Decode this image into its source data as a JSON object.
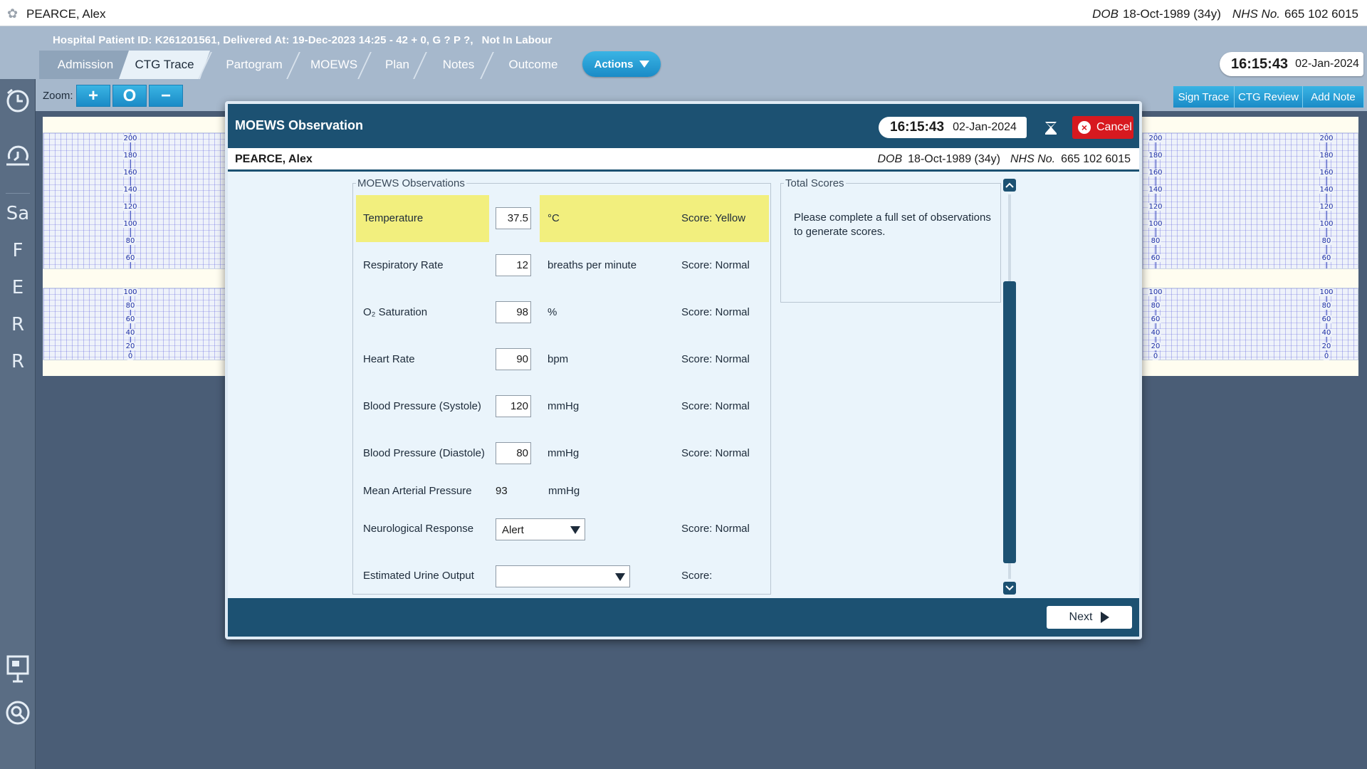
{
  "patient_bar": {
    "name": "PEARCE, Alex",
    "dob_label": "DOB",
    "dob": "18-Oct-1989 (34y)",
    "nhs_label": "NHS No.",
    "nhs": "665 102 6015"
  },
  "header": {
    "info": "Hospital Patient ID: K261201561, Delivered At: 19-Dec-2023 14:25 - 42 + 0, G ? P ?,",
    "labour_status": "Not In Labour",
    "tabs": [
      {
        "label": "Admission"
      },
      {
        "label": "CTG Trace",
        "active": true
      },
      {
        "label": "Partogram"
      },
      {
        "label": "MOEWS"
      },
      {
        "label": "Plan"
      },
      {
        "label": "Notes"
      },
      {
        "label": "Outcome"
      }
    ],
    "actions_label": "Actions",
    "time": "16:15:43",
    "date": "02-Jan-2024"
  },
  "rail": {
    "items": [
      {
        "icon": "clock-icon"
      },
      {
        "icon": "history-clock-icon"
      },
      {
        "label": "Sa"
      },
      {
        "label": "F"
      },
      {
        "label": "E"
      },
      {
        "label": "R"
      },
      {
        "label": "R"
      },
      {
        "icon": "presentation-icon"
      },
      {
        "icon": "search-icon"
      }
    ]
  },
  "zoom": {
    "label": "Zoom:",
    "buttons": [
      "+",
      "O",
      "−"
    ]
  },
  "trace_buttons": [
    "Sign Trace",
    "CTG Review",
    "Add Note"
  ],
  "ctg": {
    "fhr_ticks": [
      "200",
      "180",
      "160",
      "140",
      "120",
      "100",
      "80",
      "60"
    ],
    "toco_ticks": [
      "100",
      "80",
      "60",
      "40",
      "20",
      "0"
    ]
  },
  "modal": {
    "title": "MOEWS Observation",
    "time": "16:15:43",
    "date": "02-Jan-2024",
    "cancel_label": "Cancel",
    "patient": {
      "name": "PEARCE, Alex",
      "dob_label": "DOB",
      "dob": "18-Oct-1989 (34y)",
      "nhs_label": "NHS No.",
      "nhs": "665 102 6015"
    },
    "observations_legend": "MOEWS Observations",
    "observations": [
      {
        "name": "Temperature",
        "value": "37.5",
        "unit": "°C",
        "score": "Score: Yellow",
        "highlight": true
      },
      {
        "name": "Respiratory Rate",
        "value": "12",
        "unit": "breaths per minute",
        "score": "Score: Normal"
      },
      {
        "name": "O₂ Saturation",
        "value": "98",
        "unit": "%",
        "score": "Score: Normal"
      },
      {
        "name": "Heart Rate",
        "value": "90",
        "unit": "bpm",
        "score": "Score: Normal"
      },
      {
        "name": "Blood Pressure (Systole)",
        "value": "120",
        "unit": "mmHg",
        "score": "Score: Normal"
      },
      {
        "name": "Blood Pressure (Diastole)",
        "value": "80",
        "unit": "mmHg",
        "score": "Score: Normal"
      },
      {
        "name": "Mean Arterial Pressure",
        "value": "93",
        "unit": "mmHg",
        "score": ""
      },
      {
        "name": "Neurological Response",
        "value": "Alert",
        "unit": "",
        "score": "Score: Normal"
      },
      {
        "name": "Estimated Urine Output",
        "value": "",
        "unit": "",
        "score": "Score:"
      }
    ],
    "totals_legend": "Total Scores",
    "totals_message": "Please complete a full set of observations to generate scores.",
    "next_label": "Next"
  },
  "colors": {
    "accent": "#1a8bc7",
    "modal_dark": "#1c5172",
    "highlight_yellow": "#f2ef7e",
    "cancel_red": "#d7191f"
  }
}
